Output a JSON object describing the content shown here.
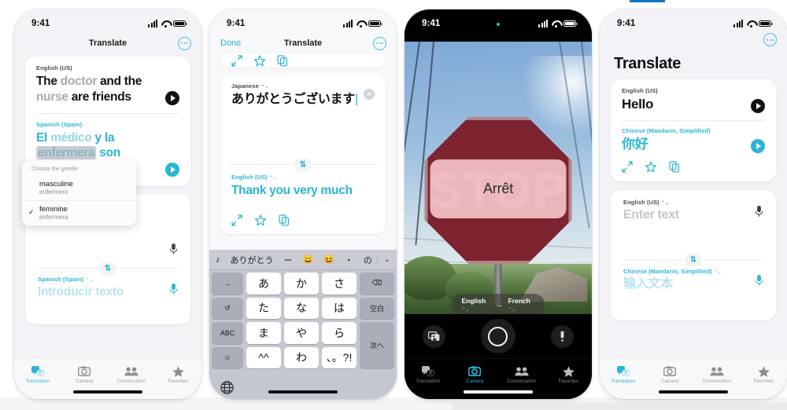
{
  "meta": {
    "accent": "#2ab5d4",
    "bg": "#ffffff",
    "status_time": "9:41"
  },
  "tabs": [
    {
      "label": "Translation",
      "icon": "translation-icon"
    },
    {
      "label": "Camera",
      "icon": "camera-icon"
    },
    {
      "label": "Conversation",
      "icon": "conversation-icon"
    },
    {
      "label": "Favorites",
      "icon": "star-icon"
    }
  ],
  "phone1": {
    "time": "9:41",
    "nav_title": "Translate",
    "card": {
      "source_lang": "English (US)",
      "source_text_1": "The ",
      "source_text_dim_1": "doctor",
      "source_text_2": " and the ",
      "source_text_dim_2": "nurse",
      "source_text_3": " are friends",
      "target_lang": "Spanish (Spain)",
      "target_text_1": "El ",
      "target_text_dim_1": "médico",
      "target_text_2": " y la ",
      "target_text_hl": "enfermera",
      "target_text_3": " son amigos"
    },
    "popover": {
      "header": "Choose the gender",
      "items": [
        {
          "title": "masculine",
          "subtitle": "enfermero",
          "checked": ""
        },
        {
          "title": "feminine",
          "subtitle": "enfermera",
          "checked": "✓"
        }
      ]
    },
    "input_card": {
      "bottom_lang": "Spanish (Spain)",
      "bottom_placeholder": "Introducir texto"
    },
    "active_tab": "Translation"
  },
  "phone2": {
    "time": "9:41",
    "nav_left": "Done",
    "nav_title": "Translate",
    "card": {
      "source_lang": "Japanese",
      "source_text": "ありがとうございます",
      "target_lang": "English (US)",
      "target_text": "Thank you very much"
    },
    "keyboard": {
      "suggestions": [
        "♪",
        "ありがとう",
        "ー",
        "😄",
        "😆",
        "・",
        "の"
      ],
      "rows": [
        [
          "→",
          "あ",
          "か",
          "さ",
          "⌫"
        ],
        [
          "↺",
          "た",
          "な",
          "は",
          "空白"
        ],
        [
          "ABC",
          "ま",
          "や",
          "ら",
          "次へ"
        ],
        [
          "☺",
          "^^",
          "わ",
          "、。?!"
        ]
      ],
      "globe": "globe-icon"
    }
  },
  "phone3": {
    "time": "9:41",
    "sign_text": "STOP",
    "overlay_text": "Arrêt",
    "lang_from": "English",
    "lang_to": "French",
    "arrow": "→",
    "controls": {
      "library": "photo-library-icon",
      "shutter": "shutter-button",
      "flash": "flashlight-icon"
    },
    "active_tab": "Camera"
  },
  "phone4": {
    "time": "9:41",
    "page_title": "Translate",
    "card": {
      "source_lang": "English (US)",
      "source_text": "Hello",
      "target_lang": "Chinese (Mandarin, Simplified)",
      "target_text": "你好"
    },
    "input_card": {
      "source_lang": "English (US)",
      "source_placeholder": "Enter text",
      "target_lang": "Chinese (Mandarin, Simplified)",
      "target_placeholder": "输入文本"
    },
    "active_tab": "Translation"
  }
}
